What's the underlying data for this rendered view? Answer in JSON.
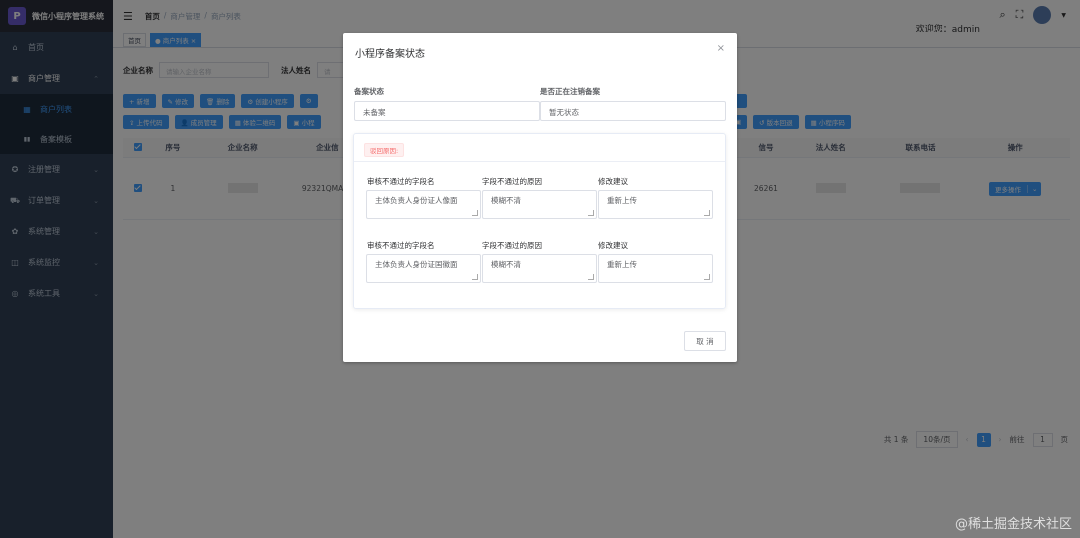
{
  "app": {
    "title": "微信小程序管理系统",
    "logo_letter": "P"
  },
  "sidebar": {
    "items": [
      {
        "label": "首页",
        "icon": "dashboard-icon",
        "glyph": "⌂"
      },
      {
        "label": "商户管理",
        "icon": "shop-icon",
        "glyph": "▣",
        "chevron": "⌃"
      },
      {
        "label": "商户列表",
        "icon": "grid-icon",
        "glyph": "▦"
      },
      {
        "label": "备案模板",
        "icon": "book-icon",
        "glyph": "▮▮"
      },
      {
        "label": "注册管理",
        "icon": "register-icon",
        "glyph": "✪",
        "chevron": "⌄"
      },
      {
        "label": "订单管理",
        "icon": "cart-icon",
        "glyph": "⛟",
        "chevron": "⌄"
      },
      {
        "label": "系统管理",
        "icon": "gear-icon",
        "glyph": "✿",
        "chevron": "⌄"
      },
      {
        "label": "系统监控",
        "icon": "monitor-icon",
        "glyph": "◫",
        "chevron": "⌄"
      },
      {
        "label": "系统工具",
        "icon": "tool-icon",
        "glyph": "◎",
        "chevron": "⌄"
      }
    ]
  },
  "header": {
    "hamburger": "☰",
    "breadcrumb": [
      "首页",
      "商户管理",
      "商户列表"
    ],
    "sep": "/",
    "search_glyph": "⌕",
    "fullscreen_glyph": "⛶",
    "welcome": "欢迎您：admin",
    "caret": "▼"
  },
  "tags": {
    "home": "首页",
    "current": "● 商户列表 ×"
  },
  "search": {
    "company_label": "企业名称",
    "company_placeholder": "请输入企业名称",
    "legal_label": "法人姓名",
    "legal_placeholder": "请"
  },
  "toolbar1": [
    "+ 新增",
    "✎ 修改",
    "🗑 删除",
    "⚙ 创建小程序",
    "⚙"
  ],
  "toolbar1b": [
    ""
  ],
  "toolbar2": [
    "⇪ 上传代码",
    "👤 成员管理",
    "▦ 体验二维码",
    "▣ 小程"
  ],
  "toolbar2b": [
    "▣",
    "↺ 版本回退",
    "▦ 小程序码"
  ],
  "table": {
    "headers": [
      "",
      "序号",
      "企业名称",
      "企业信",
      "",
      "",
      "信号",
      "法人姓名",
      "联系电话",
      "操作"
    ],
    "row": {
      "index": "1",
      "code": "92321QMA34",
      "phone_tail": "26261",
      "action": "更多操作",
      "action_dd": "⌄"
    }
  },
  "pager": {
    "total": "共 1 条",
    "size": "10条/页",
    "prev": "‹",
    "page": "1",
    "next": "›",
    "goto": "前往",
    "goto_val": "1",
    "unit": "页"
  },
  "dialog": {
    "title": "小程序备案状态",
    "close": "×",
    "status_label": "备案状态",
    "status_value": "未备案",
    "cancel_label": "是否正在注销备案",
    "cancel_value": "暂无状态",
    "reject_tag": "驳回原因:",
    "col_field": "审核不通过的字段名",
    "col_reason": "字段不通过的原因",
    "col_suggest": "修改建议",
    "groups": [
      {
        "field": "主体负责人身份证人像面",
        "reason": "模糊不清",
        "suggest": "重新上传"
      },
      {
        "field": "主体负责人身份证国徽面",
        "reason": "模糊不清",
        "suggest": "重新上传"
      }
    ],
    "cancel_button": "取 消"
  },
  "watermark": "@稀土掘金技术社区"
}
